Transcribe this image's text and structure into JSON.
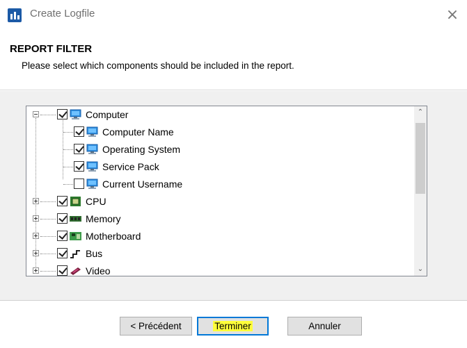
{
  "window": {
    "title": "Create Logfile",
    "close_glyph": "×",
    "app_icon": "chart-app-icon"
  },
  "header": {
    "title": "REPORT FILTER",
    "subtitle": "Please select which components should be included in the report."
  },
  "tree": {
    "items": [
      {
        "label": "Computer",
        "checked": true,
        "icon": "monitor-icon",
        "expander": "minus",
        "level": 0
      },
      {
        "label": "Computer Name",
        "checked": true,
        "icon": "monitor-icon",
        "expander": "none",
        "level": 1
      },
      {
        "label": "Operating System",
        "checked": true,
        "icon": "monitor-icon",
        "expander": "none",
        "level": 1
      },
      {
        "label": "Service Pack",
        "checked": true,
        "icon": "monitor-icon",
        "expander": "none",
        "level": 1
      },
      {
        "label": "Current Username",
        "checked": false,
        "icon": "monitor-icon",
        "expander": "none",
        "level": 1
      },
      {
        "label": "CPU",
        "checked": true,
        "icon": "cpu-icon",
        "expander": "plus",
        "level": 0
      },
      {
        "label": "Memory",
        "checked": true,
        "icon": "memory-icon",
        "expander": "plus",
        "level": 0
      },
      {
        "label": "Motherboard",
        "checked": true,
        "icon": "motherboard-icon",
        "expander": "plus",
        "level": 0
      },
      {
        "label": "Bus",
        "checked": true,
        "icon": "bus-icon",
        "expander": "plus",
        "level": 0
      },
      {
        "label": "Video",
        "checked": true,
        "icon": "video-card-icon",
        "expander": "plus",
        "level": 0
      }
    ],
    "scroll_up_glyph": "⌃",
    "scroll_down_glyph": "⌄"
  },
  "buttons": {
    "previous": "< Précédent",
    "finish": "Terminer",
    "cancel": "Annuler"
  },
  "colors": {
    "accent": "#0078d7",
    "highlight": "#ffff3a",
    "monitor": "#2f8fe0"
  }
}
